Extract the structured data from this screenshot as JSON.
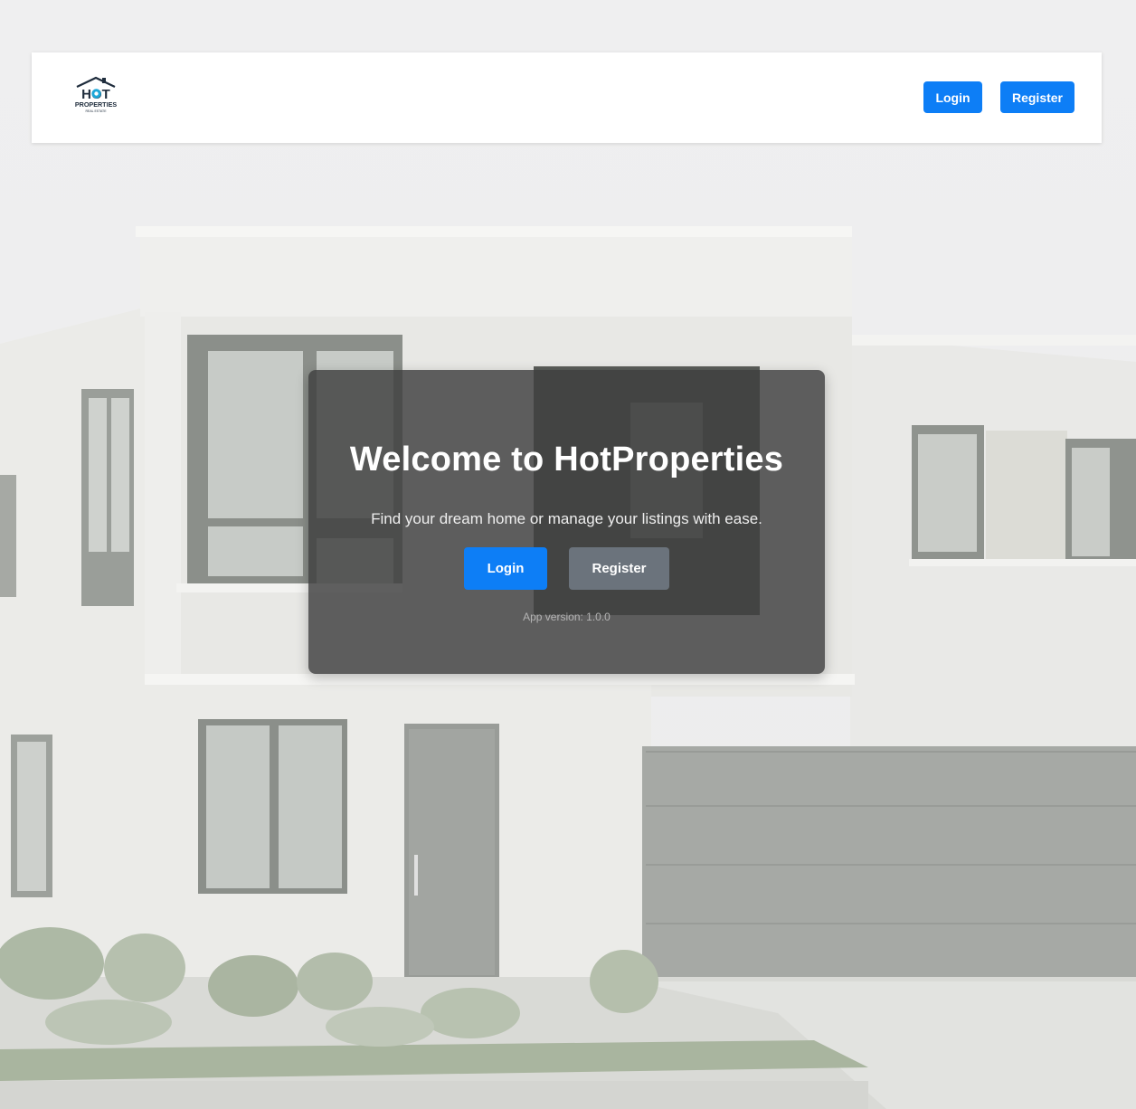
{
  "navbar": {
    "logo": {
      "top_text": "HOT",
      "middle_text": "PROPERTIES",
      "bottom_text": "REAL ESTATE",
      "icon": "house-roof-icon"
    },
    "login_label": "Login",
    "register_label": "Register"
  },
  "hero": {
    "title": "Welcome to HotProperties",
    "subtitle": "Find your dream home or manage your listings with ease.",
    "login_label": "Login",
    "register_label": "Register",
    "version_text": "App version: 1.0.0"
  },
  "colors": {
    "primary": "#0d7ef6",
    "secondary": "#6b737c",
    "overlay": "#3e3e3e",
    "navbar_bg": "#ffffff"
  }
}
